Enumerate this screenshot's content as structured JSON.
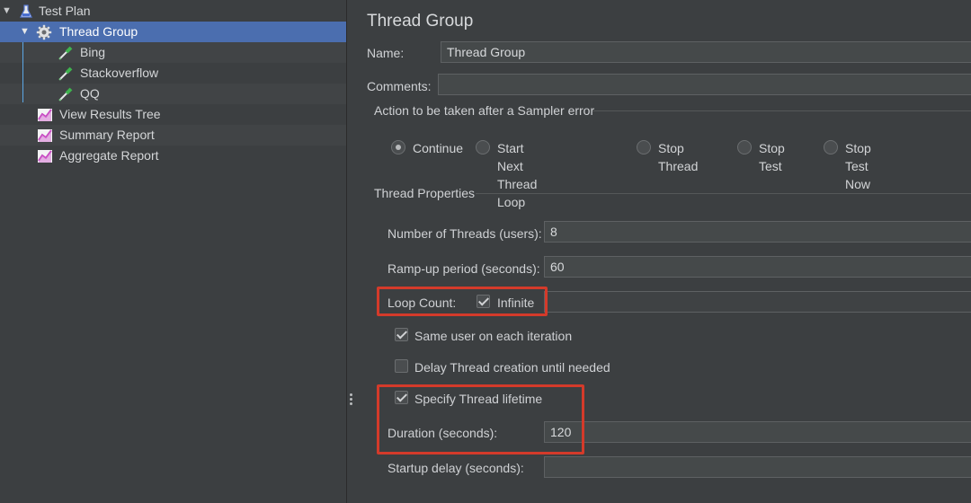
{
  "tree": {
    "items": [
      {
        "label": "Test Plan",
        "icon": "flask-icon"
      },
      {
        "label": "Thread Group",
        "icon": "gear-icon"
      },
      {
        "label": "Bing",
        "icon": "pipette-icon"
      },
      {
        "label": "Stackoverflow",
        "icon": "pipette-icon"
      },
      {
        "label": "QQ",
        "icon": "pipette-icon"
      },
      {
        "label": "View Results Tree",
        "icon": "graph-icon"
      },
      {
        "label": "Summary Report",
        "icon": "graph-icon"
      },
      {
        "label": "Aggregate Report",
        "icon": "graph-icon"
      }
    ]
  },
  "panel": {
    "title": "Thread Group",
    "name_label": "Name:",
    "name_value": "Thread Group",
    "comments_label": "Comments:",
    "comments_value": "",
    "sampler_error": {
      "legend": "Action to be taken after a Sampler error",
      "options": [
        "Continue",
        "Start Next Thread Loop",
        "Stop Thread",
        "Stop Test",
        "Stop Test Now"
      ],
      "selected": "Continue"
    },
    "thread_props": {
      "legend": "Thread Properties",
      "threads_label": "Number of Threads (users):",
      "threads_value": "8",
      "rampup_label": "Ramp-up period (seconds):",
      "rampup_value": "60",
      "loop_label": "Loop Count:",
      "infinite_label": "Infinite",
      "infinite_checked": true,
      "same_user_label": "Same user on each iteration",
      "same_user_checked": true,
      "delay_label": "Delay Thread creation until needed",
      "delay_checked": false,
      "lifetime_label": "Specify Thread lifetime",
      "lifetime_checked": true,
      "duration_label": "Duration (seconds):",
      "duration_value": "120",
      "startup_label": "Startup delay (seconds):",
      "startup_value": ""
    }
  },
  "colors": {
    "selection": "#4b6eaf",
    "highlight": "#d43a2a",
    "background": "#3c3f41"
  }
}
